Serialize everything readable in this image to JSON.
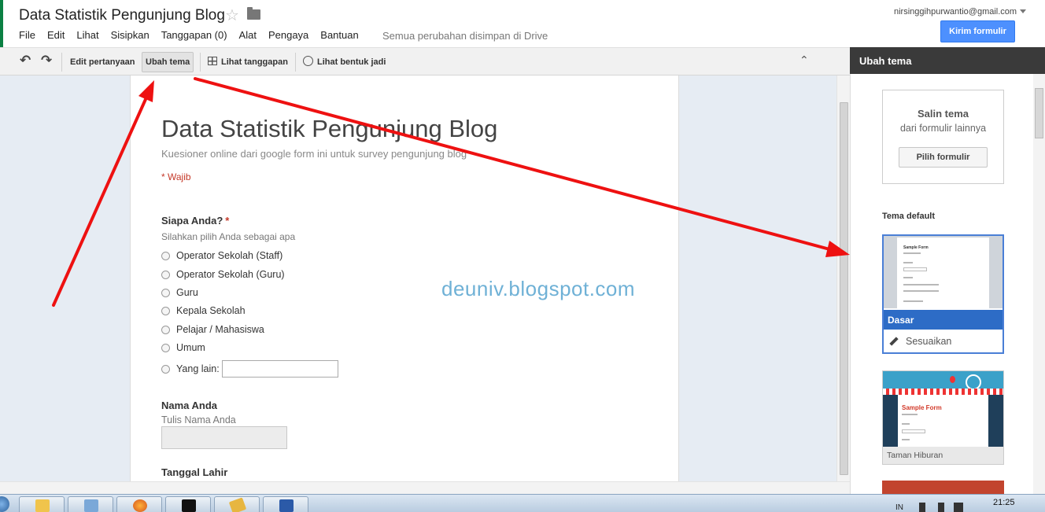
{
  "header": {
    "doc_title": "Data Statistik Pengunjung Blog",
    "star": "☆",
    "menu": [
      "File",
      "Edit",
      "Lihat",
      "Sisipkan",
      "Tanggapan (0)",
      "Alat",
      "Pengaya",
      "Bantuan"
    ],
    "save_status": "Semua perubahan disimpan di Drive",
    "account_email": "nirsinggihpurwantio@gmail.com",
    "send_label": "Kirim formulir"
  },
  "toolbar": {
    "undo": "↶",
    "redo": "↷",
    "edit_questions": "Edit pertanyaan",
    "change_theme": "Ubah tema",
    "view_responses": "Lihat tanggapan",
    "view_live": "Lihat bentuk jadi",
    "collapse": "⌃"
  },
  "form": {
    "title": "Data Statistik Pengunjung Blog",
    "description": "Kuesioner online dari google form ini untuk survey pengunjung blog",
    "required_note": "* Wajib",
    "q1": {
      "title": "Siapa Anda?",
      "required_mark": "*",
      "help": "Silahkan pilih Anda sebagai apa",
      "options": [
        "Operator Sekolah (Staff)",
        "Operator Sekolah (Guru)",
        "Guru",
        "Kepala Sekolah",
        "Pelajar / Mahasiswa",
        "Umum"
      ],
      "other_label": "Yang lain:"
    },
    "q2": {
      "title": "Nama Anda",
      "help": "Tulis Nama Anda"
    },
    "q3": {
      "title": "Tanggal Lahir"
    }
  },
  "watermark": "deuniv.blogspot.com",
  "panel": {
    "title": "Ubah tema",
    "copy_title": "Salin tema",
    "copy_sub": "dari formulir lainnya",
    "pick_button": "Pilih formulir",
    "default_label": "Tema default",
    "theme1": {
      "thumb_title": "Sample Form",
      "name": "Dasar",
      "customize": "Sesuaikan"
    },
    "theme2": {
      "thumb_title": "Sample Form",
      "name": "Taman Hiburan"
    }
  },
  "taskbar": {
    "lang": "IN",
    "clock": "21:25"
  },
  "colors": {
    "accent_blue": "#4d90fe",
    "required_red": "#c53929",
    "annotation_red": "#ee1111",
    "panel_header": "#3a3a3a"
  }
}
